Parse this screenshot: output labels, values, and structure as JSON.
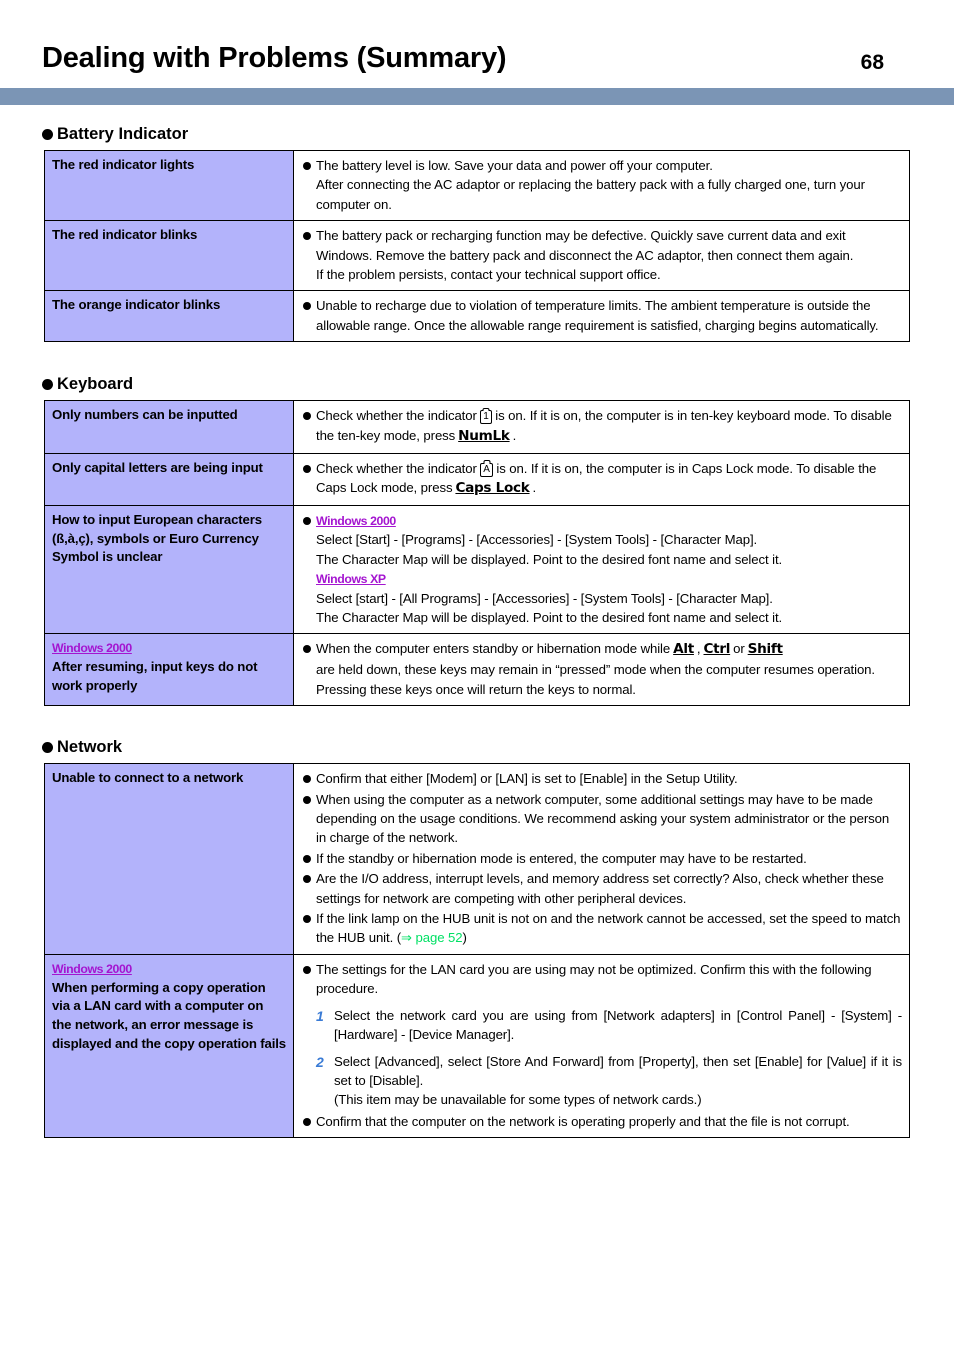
{
  "header": {
    "title": "Dealing with Problems (Summary)",
    "page_number": "68",
    "bar_color": "#7b95b5"
  },
  "colors": {
    "key_cell_background": "#b3b3fb",
    "windows_label": "#a415d0",
    "page_reference": "#00e064",
    "step_number": "#3a7bd5"
  },
  "sections": [
    {
      "id": "battery-indicator",
      "heading": "Battery Indicator",
      "rows": [
        {
          "key": "The red indicator lights",
          "items": [
            {
              "type": "bullet",
              "lines": [
                "The battery level is low.  Save your data and power off your computer.",
                "After connecting the AC adaptor or replacing the battery pack with a fully charged one, turn your computer on."
              ]
            }
          ]
        },
        {
          "key": "The red indicator blinks",
          "items": [
            {
              "type": "bullet",
              "lines": [
                "The battery pack or recharging function may be defective. Quickly save current data and exit Windows.  Remove the battery pack and disconnect the AC adaptor, then connect them again.",
                "If the problem persists, contact your technical support office."
              ]
            }
          ]
        },
        {
          "key": "The orange indicator blinks",
          "items": [
            {
              "type": "bullet",
              "lines": [
                "Unable to recharge due to violation of temperature limits. The ambient temperature is outside the allowable range. Once the allowable range requirement is satisfied, charging begins automatically."
              ]
            }
          ]
        }
      ]
    },
    {
      "id": "keyboard",
      "heading": "Keyboard",
      "rows": [
        {
          "key": "Only numbers can be inputted",
          "text_before_indicator": "Check whether the indicator",
          "indicator_glyph": "1",
          "text_after_indicator": "is on. If it is on, the computer is in ten-key keyboard mode. To disable the ten-key mode, press",
          "keycap": "NumLk",
          "text_end": "."
        },
        {
          "key": "Only capital letters are being input",
          "text_before_indicator": "Check whether the indicator",
          "indicator_glyph": "A",
          "text_after_indicator": "is on. If it is on, the computer is in Caps Lock mode. To disable the Caps Lock mode, press",
          "keycap": "Caps Lock",
          "text_end": "."
        },
        {
          "key": "How to input European characters (ß,à,ç), symbols or Euro Currency Symbol is unclear",
          "os_blocks": [
            {
              "os": "Windows 2000",
              "lines": [
                "Select [Start] - [Programs] - [Accessories] - [System Tools] - [Character Map].",
                "The Character Map will be displayed. Point to the desired font name and select it."
              ]
            },
            {
              "os": "Windows XP",
              "lines": [
                "Select [start] - [All Programs] - [Accessories] - [System Tools] - [Character Map].",
                "The Character Map will be displayed. Point to the desired font name and select it."
              ]
            }
          ]
        },
        {
          "key_os_label": "Windows 2000",
          "key": "After resuming, input keys do not work properly",
          "resume_text_1": "When the computer enters standby or hibernation mode while",
          "key_alt": "Alt",
          "resume_sep_1": ",",
          "key_ctrl": "Ctrl",
          "resume_sep_2": "or",
          "key_shift": "Shift",
          "resume_text_2": "are held down, these keys may remain in “pressed” mode when the computer resumes operation. Pressing these keys once will return the keys to normal."
        }
      ]
    },
    {
      "id": "network",
      "heading": "Network",
      "rows": [
        {
          "key": "Unable to connect to a network",
          "bullets": [
            "Confirm that either [Modem] or [LAN] is set to [Enable] in the Setup Utility.",
            "When using the computer as a network computer, some additional settings may have to be made depending on the usage conditions. We recommend asking your system administrator or the person in charge of the network.",
            "If the standby or hibernation mode is entered, the computer may have to be restarted.",
            "Are the I/O address, interrupt levels, and memory address set correctly? Also, check whether these settings for network are competing with other peripheral devices."
          ],
          "last_bullet_text": "If the link lamp on the HUB unit is not on and the network cannot be accessed, set the speed to match the HUB unit. (",
          "page_ref": "⇒ page 52",
          "last_bullet_tail": ")"
        },
        {
          "key_os_label": "Windows 2000",
          "key": "When performing a copy operation via a LAN card with a computer on the network, an error message is displayed and the copy operation fails",
          "intro_bullet": "The settings for the LAN card you are using may not be optimized. Confirm this with the following procedure.",
          "steps": [
            {
              "num": "1",
              "text": "Select the network card you are using from [Network adapters] in [Control Panel] - [System] - [Hardware] - [Device Manager]."
            },
            {
              "num": "2",
              "text": "Select [Advanced], select [Store And Forward] from [Property], then set [Enable] for [Value] if it is set to [Disable].",
              "subtext": "(This item may be unavailable for some types of network cards.)"
            }
          ],
          "closing_bullet": "Confirm that the computer on the network is operating properly and that the file is not corrupt."
        }
      ]
    }
  ]
}
